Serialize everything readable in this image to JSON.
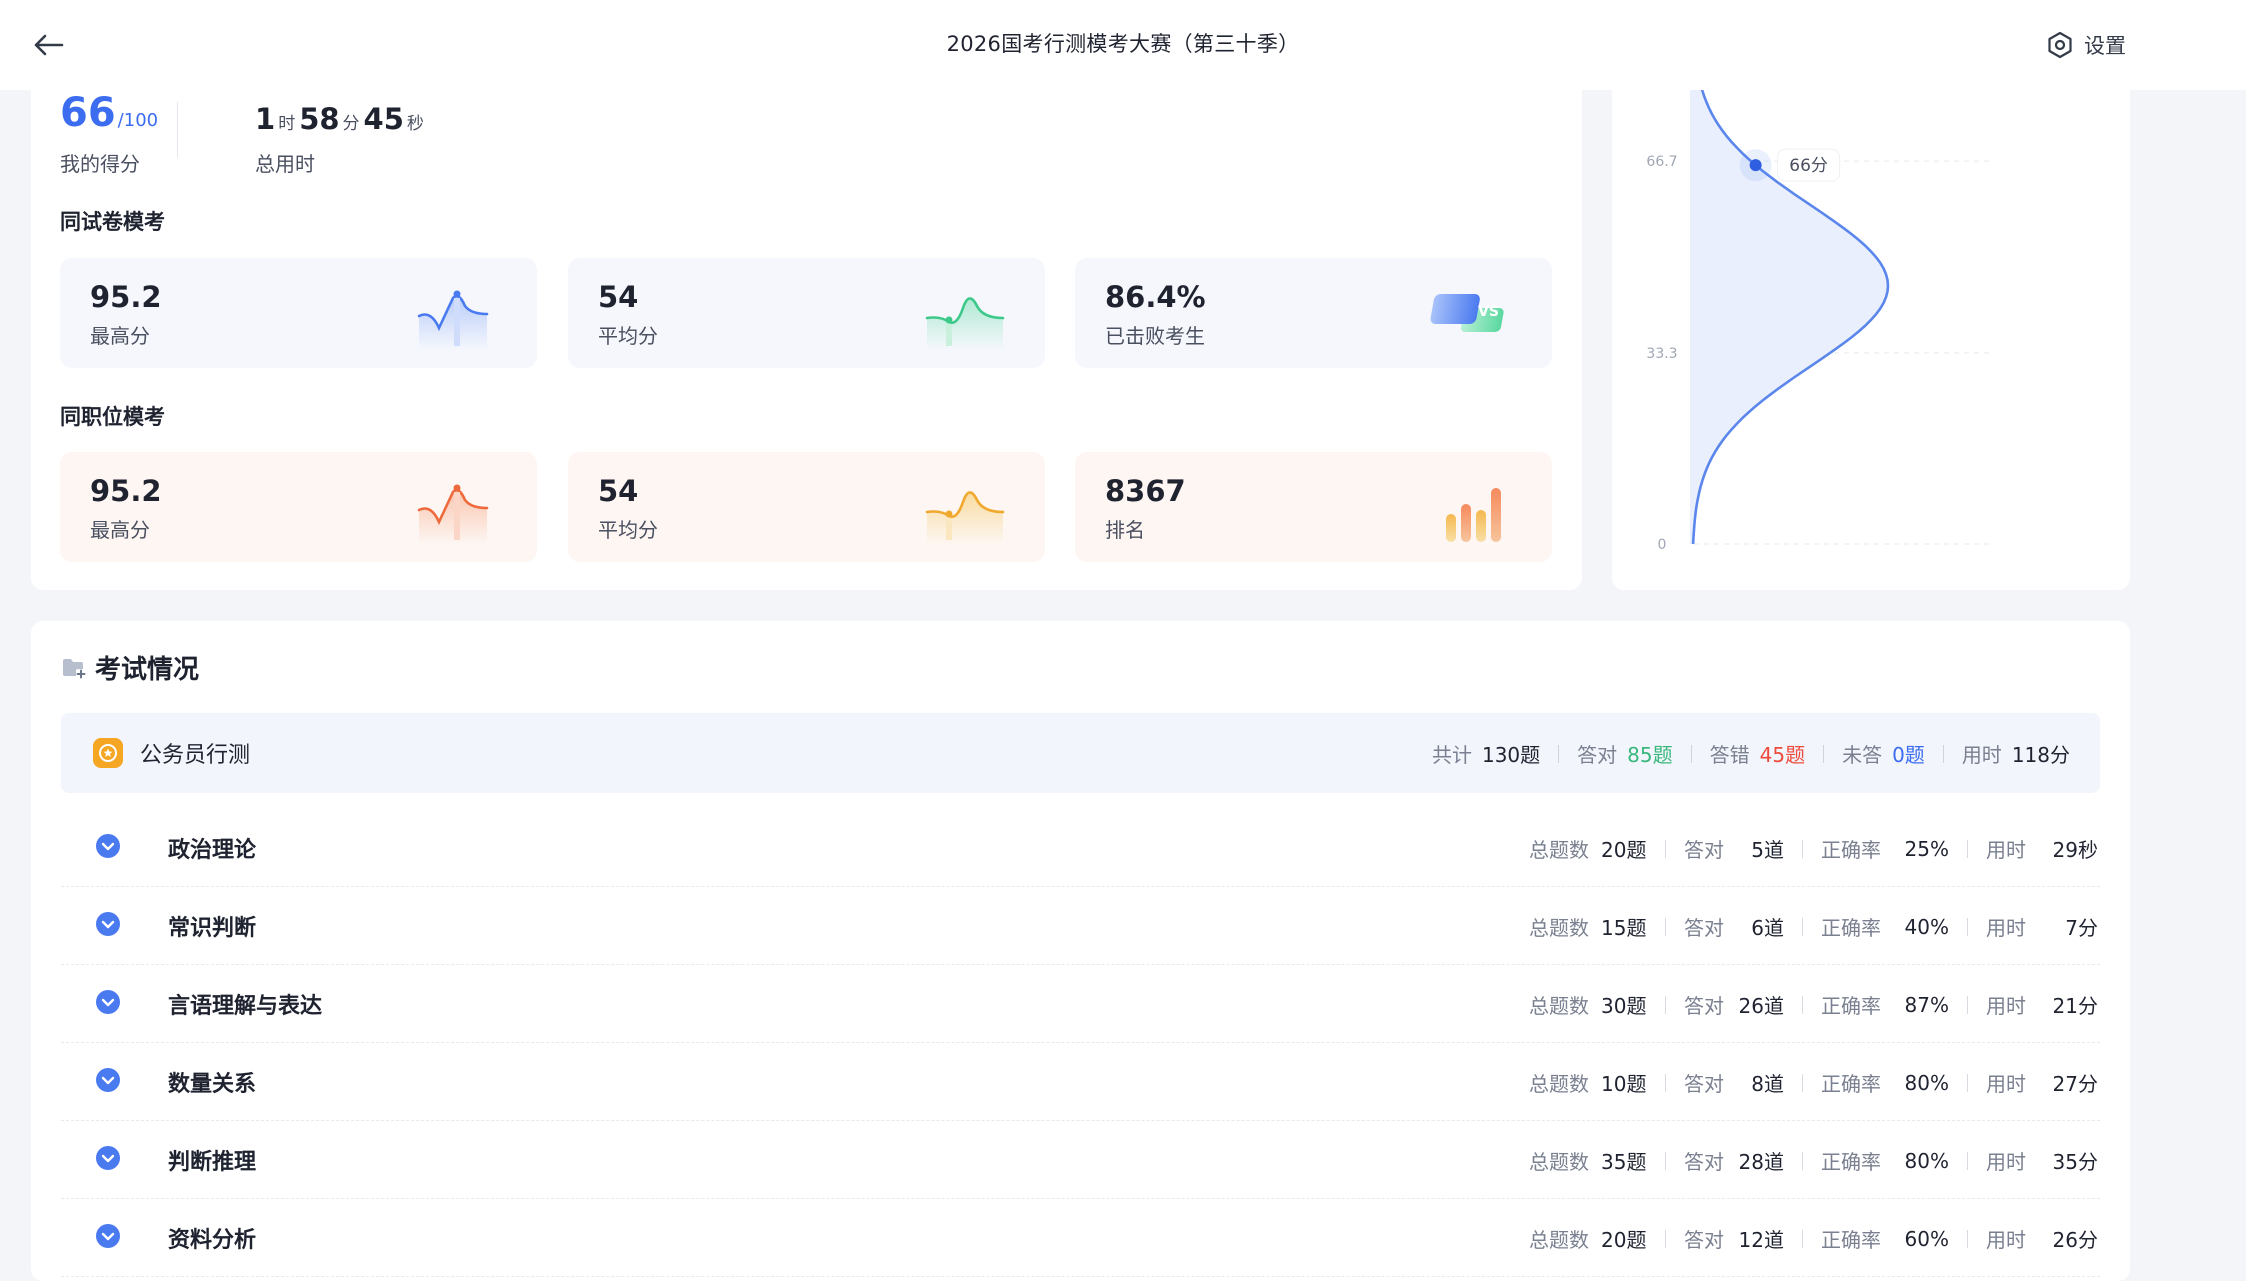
{
  "header": {
    "title": "2026国考行测模考大赛（第三十季）",
    "settings_label": "设置",
    "icons": {
      "back": "arrow-left-icon",
      "settings": "hexagon-gear-icon"
    }
  },
  "summary": {
    "score": "66",
    "score_total": "/100",
    "score_label": "我的得分",
    "time": {
      "h": "1",
      "h_unit": "时",
      "m": "58",
      "m_unit": "分",
      "s": "45",
      "s_unit": "秒"
    },
    "time_label": "总用时"
  },
  "same_paper": {
    "title": "同试卷模考",
    "stats": [
      {
        "value": "95.2",
        "label": "最高分",
        "icon": "line-peak-icon"
      },
      {
        "value": "54",
        "label": "平均分",
        "icon": "line-wave-icon"
      },
      {
        "value": "86.4%",
        "label": "已击败考生",
        "icon": "vs-icon"
      }
    ]
  },
  "same_position": {
    "title": "同职位模考",
    "stats": [
      {
        "value": "95.2",
        "label": "最高分",
        "icon": "line-peak-icon"
      },
      {
        "value": "54",
        "label": "平均分",
        "icon": "line-wave-icon"
      },
      {
        "value": "8367",
        "label": "排名",
        "icon": "bar-rank-icon"
      }
    ]
  },
  "distribution": {
    "y_ticks": [
      "0",
      "33.3",
      "66.7"
    ],
    "marker_label": "66分",
    "marker_score": 66,
    "colors": {
      "line": "#5b86ec",
      "fill": "#e8eefc"
    }
  },
  "exam": {
    "title": "考试情况",
    "subject": {
      "name": "公务员行测",
      "total_label": "共计",
      "total_value": "130题",
      "correct_label": "答对",
      "correct_value": "85题",
      "wrong_label": "答错",
      "wrong_value": "45题",
      "unanswered_label": "未答",
      "unanswered_value": "0题",
      "time_label": "用时",
      "time_value": "118分"
    },
    "col_labels": {
      "count": "总题数",
      "correct": "答对",
      "rate": "正确率",
      "time": "用时"
    },
    "modules": [
      {
        "name": "政治理论",
        "count": "20题",
        "correct": "5道",
        "rate": "25%",
        "time": "29秒"
      },
      {
        "name": "常识判断",
        "count": "15题",
        "correct": "6道",
        "rate": "40%",
        "time": "7分"
      },
      {
        "name": "言语理解与表达",
        "count": "30题",
        "correct": "26道",
        "rate": "87%",
        "time": "21分"
      },
      {
        "name": "数量关系",
        "count": "10题",
        "correct": "8道",
        "rate": "80%",
        "time": "27分"
      },
      {
        "name": "判断推理",
        "count": "35题",
        "correct": "28道",
        "rate": "80%",
        "time": "35分"
      },
      {
        "name": "资料分析",
        "count": "20题",
        "correct": "12道",
        "rate": "60%",
        "time": "26分"
      }
    ]
  },
  "colors": {
    "accent": "#3c6cf0",
    "correct": "#39b77d",
    "wrong": "#ee4b3d",
    "subject_icon": "#f5a623"
  }
}
